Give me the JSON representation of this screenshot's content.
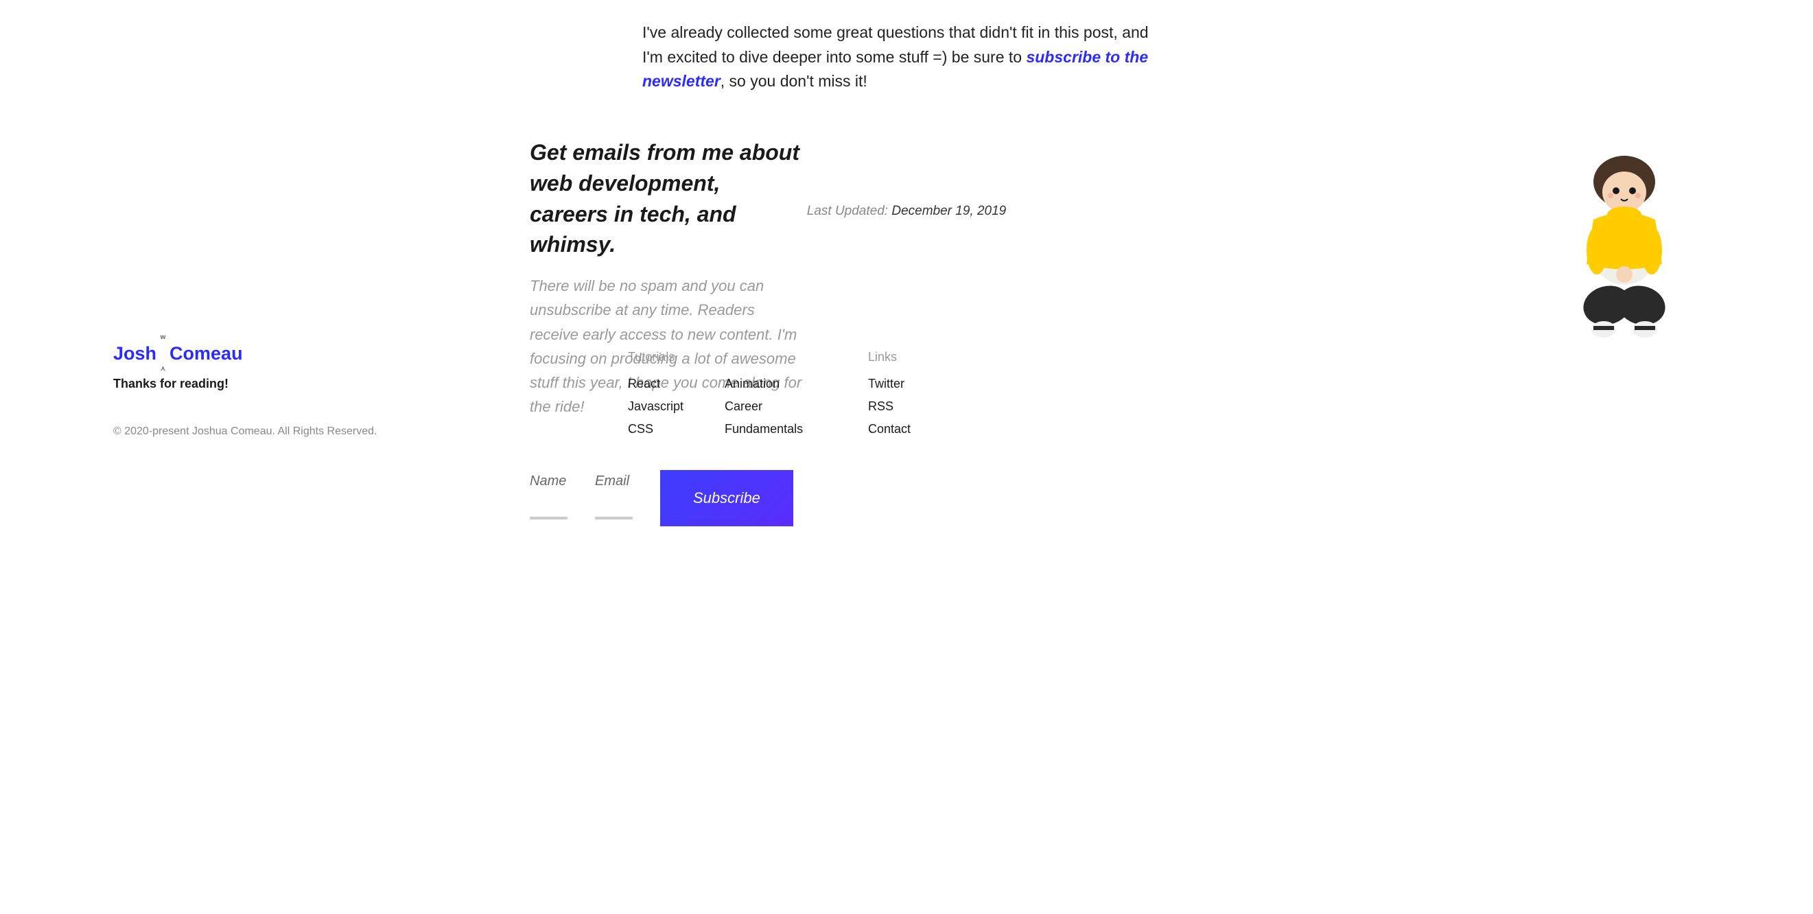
{
  "article": {
    "paragraph_before": "I've already collected some great questions that didn't fit in this post, and I'm excited to dive deeper into some stuff =) be sure to ",
    "link_text": "subscribe to the newsletter",
    "paragraph_after": ", so you don't miss it!"
  },
  "lastUpdated": {
    "label": "Last Updated:",
    "date": "December 19, 2019"
  },
  "newsletter": {
    "heading": "Get emails from me about web development, careers in tech, and whimsy.",
    "description": "There will be no spam and you can unsubscribe at any time. Readers receive early access to new content. I'm focusing on producing a lot of awesome stuff this year, I hope you come along for the ride!",
    "name_label": "Name",
    "email_label": "Email",
    "subscribe_label": "Subscribe"
  },
  "footer": {
    "logo_first": "Josh",
    "logo_last": "Comeau",
    "thanks": "Thanks for reading!",
    "copyright": "© 2020-present Joshua Comeau. All Rights Reserved."
  },
  "nav": {
    "tutorials": {
      "heading": "Tutorials",
      "col1": [
        "React",
        "Javascript",
        "CSS"
      ],
      "col2": [
        "Animation",
        "Career",
        "Fundamentals"
      ]
    },
    "links": {
      "heading": "Links",
      "items": [
        "Twitter",
        "RSS",
        "Contact"
      ]
    }
  }
}
